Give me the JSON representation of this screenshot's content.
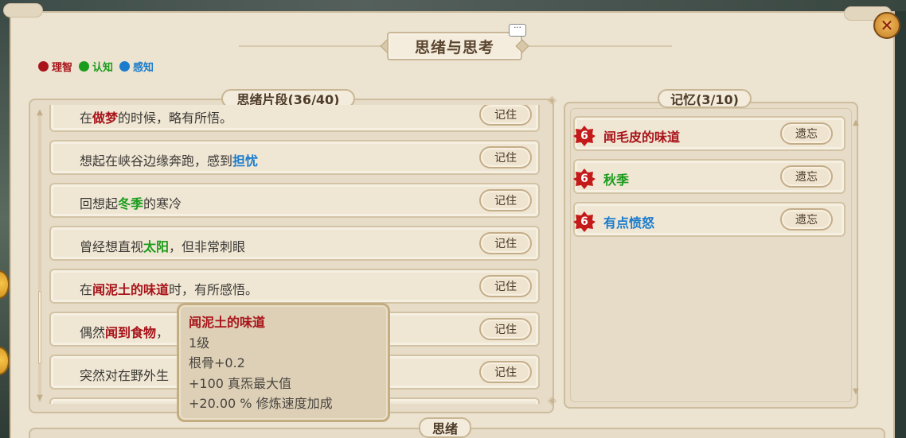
{
  "header": {
    "title": "思绪与思考",
    "chat_icon": "···",
    "close_icon": "✕"
  },
  "legend": [
    {
      "label": "理智",
      "color": "#a8141a"
    },
    {
      "label": "认知",
      "color": "#1c9c1c"
    },
    {
      "label": "感知",
      "color": "#1a7ccc"
    }
  ],
  "fragments": {
    "title": "思绪片段(36/40)",
    "button_label": "记住",
    "items": [
      {
        "pre": "在",
        "hl": "做梦",
        "post": "的时候，略有所悟。",
        "color": "red"
      },
      {
        "pre": "想起在峡谷边缘奔跑，感到",
        "hl": "担忧",
        "post": "",
        "color": "blue"
      },
      {
        "pre": "回想起",
        "hl": "冬季",
        "post": "的寒冷",
        "color": "green"
      },
      {
        "pre": "曾经想直视",
        "hl": "太阳",
        "post": "，但非常刺眼",
        "color": "green"
      },
      {
        "pre": "在",
        "hl": "闻泥土的味道",
        "post": "时，有所感悟。",
        "color": "red"
      },
      {
        "pre": "偶然",
        "hl": "闻到食物",
        "post": "，",
        "color": "red"
      },
      {
        "pre": "突然对在野外生",
        "hl": "",
        "post": "",
        "color": "red"
      }
    ]
  },
  "memory": {
    "title": "记忆(3/10)",
    "button_label": "遗忘",
    "items": [
      {
        "badge": "6",
        "label": "闻毛皮的味道",
        "color": "red"
      },
      {
        "badge": "6",
        "label": "秋季",
        "color": "green"
      },
      {
        "badge": "6",
        "label": "有点愤怒",
        "color": "blue"
      }
    ]
  },
  "tooltip": {
    "title": "闻泥土的味道",
    "level": "1级",
    "lines": [
      "根骨+0.2",
      "+100  真炁最大值",
      "+20.00 %  修炼速度加成"
    ]
  },
  "footer": {
    "title": "思绪"
  }
}
